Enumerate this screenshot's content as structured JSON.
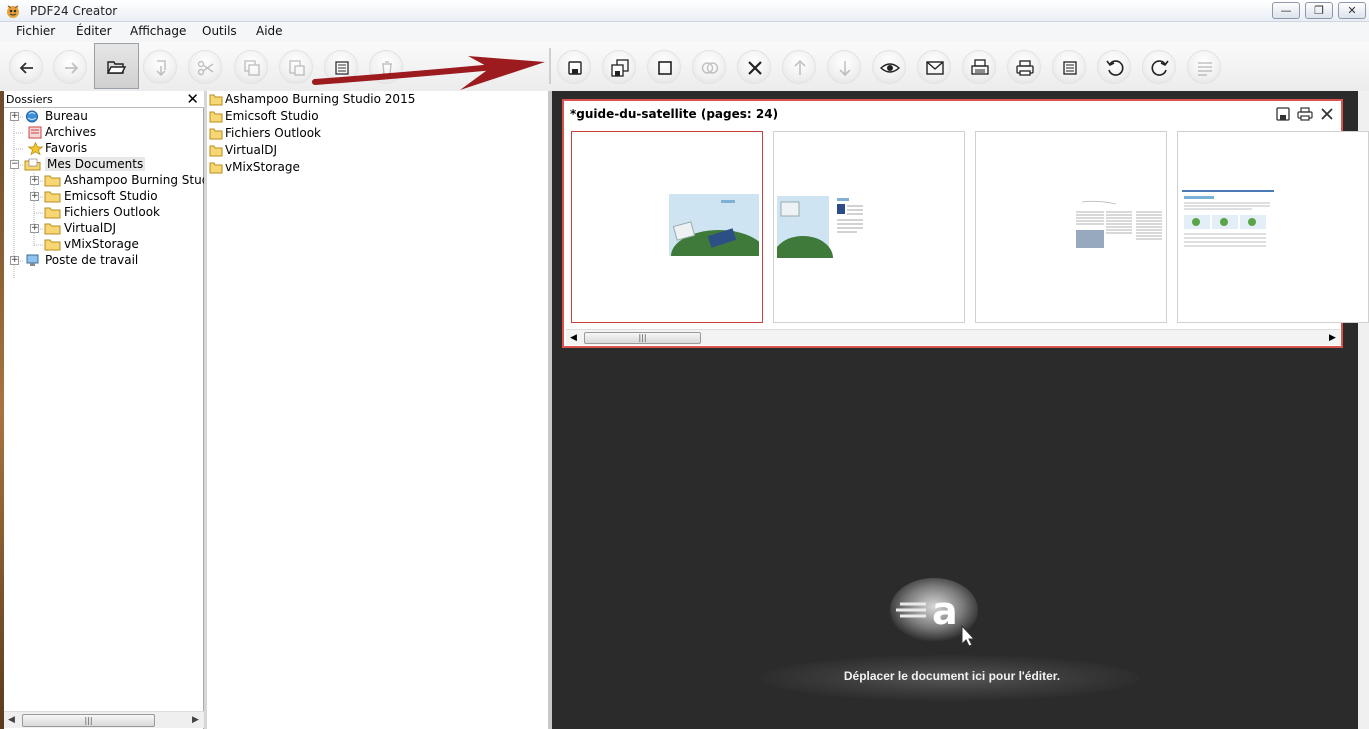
{
  "window": {
    "title": "PDF24 Creator",
    "buttons": {
      "minimize": "—",
      "restore": "❐",
      "close": "✕"
    }
  },
  "menu": [
    "Fichier",
    "Éditer",
    "Affichage",
    "Outils",
    "Aide"
  ],
  "toolbar": {
    "left_buttons": [
      "back-icon",
      "forward-icon",
      "open-folder-icon",
      "import-icon",
      "cut-icon",
      "copy-icon",
      "paste-icon",
      "grid-icon",
      "trash-icon"
    ],
    "right_buttons": [
      "save-icon",
      "save-as-icon",
      "blank-page-icon",
      "merge-icon",
      "delete-icon",
      "move-up-icon",
      "move-down-icon",
      "preview-icon",
      "email-icon",
      "fax-icon",
      "print-icon",
      "grid-icon",
      "rotate-left-icon",
      "rotate-right-icon",
      "align-icon"
    ]
  },
  "tree": {
    "header": "Dossiers",
    "close": "✕",
    "items": [
      {
        "label": "Bureau",
        "icon": "desktop-icon",
        "level": 0,
        "expander": "+"
      },
      {
        "label": "Archives",
        "icon": "archive-icon",
        "level": 0,
        "expander": ""
      },
      {
        "label": "Favoris",
        "icon": "star-icon",
        "level": 0,
        "expander": ""
      },
      {
        "label": "Mes Documents",
        "icon": "documents-icon",
        "level": 0,
        "expander": "−"
      },
      {
        "label": "Ashampoo Burning Stud",
        "icon": "folder-icon",
        "level": 1,
        "expander": "+"
      },
      {
        "label": "Emicsoft Studio",
        "icon": "folder-icon",
        "level": 1,
        "expander": "+"
      },
      {
        "label": "Fichiers Outlook",
        "icon": "folder-icon",
        "level": 1,
        "expander": ""
      },
      {
        "label": "VirtualDJ",
        "icon": "folder-icon",
        "level": 1,
        "expander": "+"
      },
      {
        "label": "vMixStorage",
        "icon": "folder-icon",
        "level": 1,
        "expander": ""
      },
      {
        "label": "Poste de travail",
        "icon": "computer-icon",
        "level": 0,
        "expander": "+"
      }
    ],
    "scroll_thumb": "|||"
  },
  "files": [
    "Ashampoo Burning Studio 2015",
    "Emicsoft Studio",
    "Fichiers Outlook",
    "VirtualDJ",
    "vMixStorage"
  ],
  "document": {
    "title": "*guide-du-satellite (pages: 24)",
    "scroll_thumb": "|||"
  },
  "drop_zone": {
    "text": "Déplacer le document ici pour l'éditer.",
    "logo_letter": "a"
  },
  "colors": {
    "accent_red": "#d9534f",
    "editor_bg": "#2b2b2b",
    "arrow_red": "#9b1b1e"
  }
}
